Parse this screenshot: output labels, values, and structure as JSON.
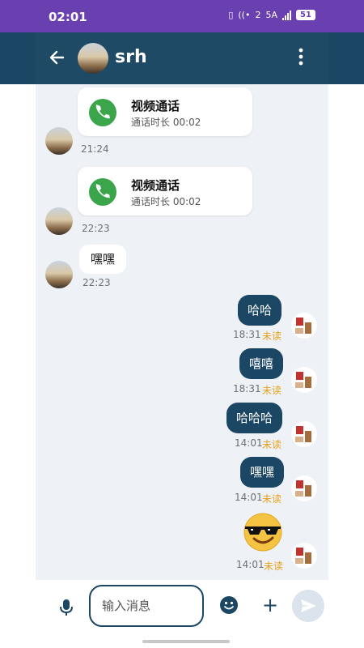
{
  "status_bar": {
    "time": "02:01",
    "wifi": "2",
    "network": "5A",
    "battery": "51"
  },
  "header": {
    "contact_name": "srh"
  },
  "messages": [
    {
      "call_title": "视频通话",
      "duration": "通话时长 00:02",
      "time": "21:24"
    },
    {
      "call_title": "视频通话",
      "duration": "通话时长 00:02",
      "time": "22:23"
    },
    {
      "text": "嘿嘿",
      "time": "22:23"
    }
  ],
  "my_messages": [
    {
      "text": "哈哈",
      "time": "18:31",
      "status": "未读"
    },
    {
      "text": "嘻嘻",
      "time": "18:31",
      "status": "未读"
    },
    {
      "text": "哈哈哈",
      "time": "14:01",
      "status": "未读"
    },
    {
      "text": "嘿嘿",
      "time": "14:01",
      "status": "未读"
    },
    {
      "text": "😎",
      "time": "14:01",
      "status": "未读"
    }
  ],
  "input": {
    "placeholder": "输入消息"
  },
  "icons": {
    "back": "arrow-left-icon",
    "more": "more-vertical-icon",
    "phone": "phone-icon",
    "mic": "microphone-icon",
    "emoji": "smiley-icon",
    "plus": "plus-icon",
    "send": "send-icon"
  },
  "colors": {
    "header": "#1b4764",
    "status_bar": "#6a3fb0",
    "call_green": "#3aa54a",
    "unread": "#e6a11c",
    "chat_bg": "#eef1f6"
  }
}
